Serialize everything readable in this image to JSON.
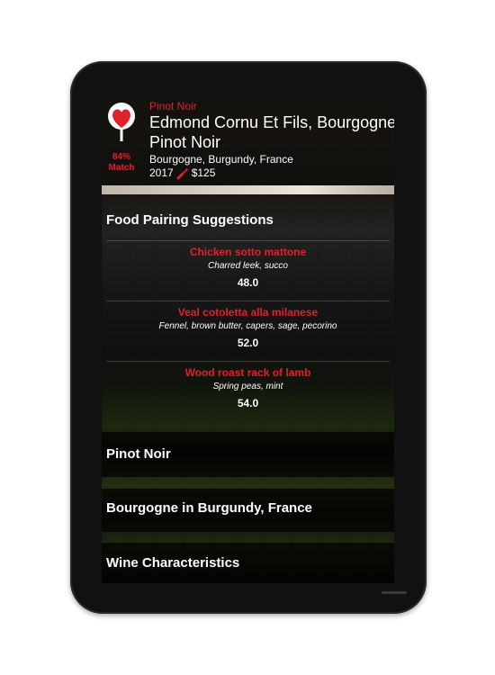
{
  "wine": {
    "varietal": "Pinot Noir",
    "name": "Edmond Cornu Et Fils, Bourgogne Pinot Noir",
    "region": "Bourgogne, Burgundy, France",
    "vintage": "2017",
    "price": "$125",
    "match_percent": "84%",
    "match_label": "Match",
    "badge_color": "#e0202a"
  },
  "food_pairing": {
    "title": "Food Pairing Suggestions",
    "items": [
      {
        "name": "Chicken sotto mattone",
        "description": "Charred leek, succo",
        "score": "48.0"
      },
      {
        "name": "Veal cotoletta alla milanese",
        "description": "Fennel, brown butter, capers, sage, pecorino",
        "score": "52.0"
      },
      {
        "name": "Wood roast rack of lamb",
        "description": "Spring peas, mint",
        "score": "54.0"
      }
    ]
  },
  "sections": [
    {
      "title": "Pinot Noir"
    },
    {
      "title": "Bourgogne in Burgundy, France"
    },
    {
      "title": "Wine Characteristics"
    }
  ],
  "icons": {
    "badge": "wine-glass-heart-icon",
    "bottle": "wine-bottle-icon"
  }
}
